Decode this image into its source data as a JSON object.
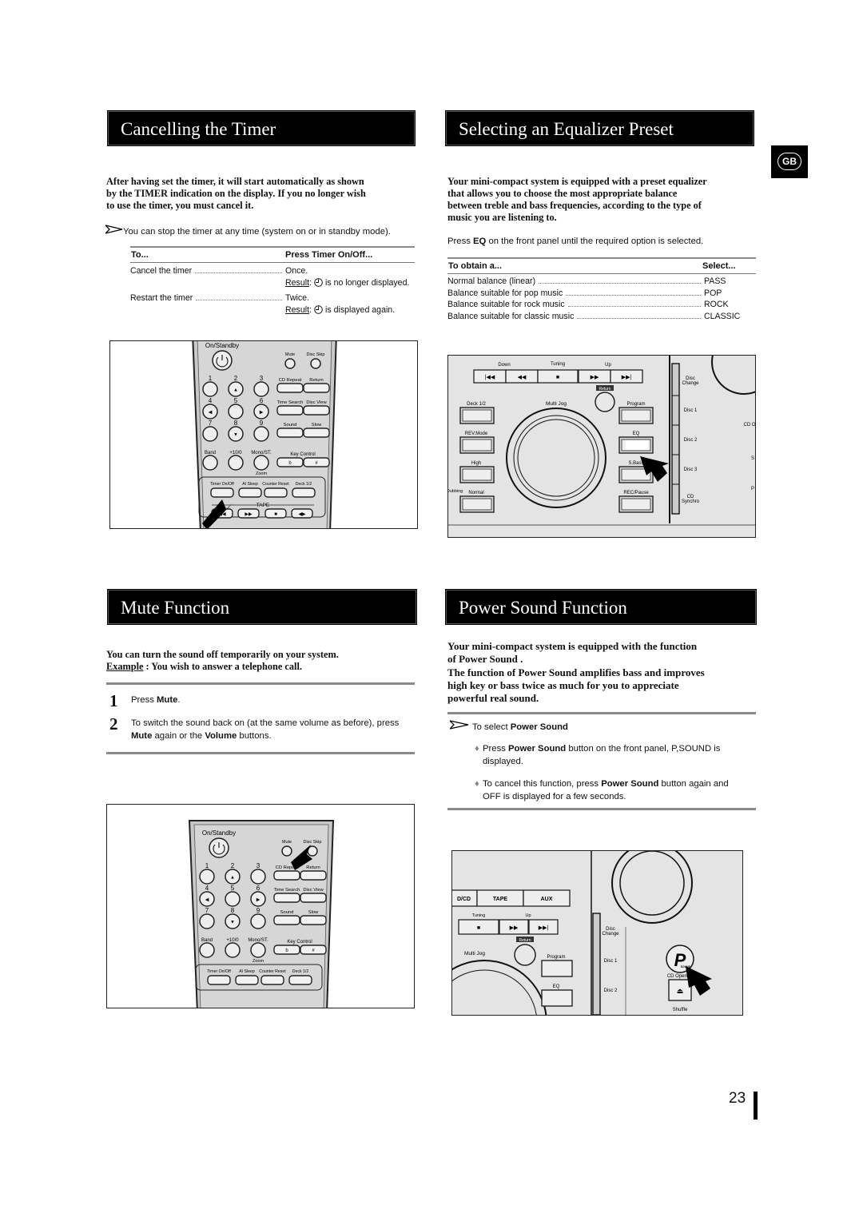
{
  "page_number": "23",
  "language_badge": "GB",
  "cancel_timer": {
    "title": "Cancelling the Timer",
    "intro": [
      "After having set the timer, it will start automatically as shown",
      "by the TIMER indication on the display. If you no longer wish",
      "to use the timer, you must cancel it."
    ],
    "note": "You can stop the timer at any time (system on or in standby mode).",
    "table_headers": [
      "To...",
      "Press Timer On/Off..."
    ],
    "rows": [
      {
        "action": "Cancel the timer",
        "value": "Once.",
        "result_label": "Result",
        "result_text": "is no longer displayed."
      },
      {
        "action": "Restart the timer",
        "value": "Twice.",
        "result_label": "Result",
        "result_text": "is displayed again."
      }
    ]
  },
  "equalizer": {
    "title": "Selecting an Equalizer Preset",
    "intro": [
      "Your mini-compact system is equipped with a preset equalizer",
      "that allows you to choose the most appropriate balance",
      "between treble and bass frequencies, according to the type of",
      "music you are listening to."
    ],
    "press_pre": "Press ",
    "press_bold": "EQ",
    "press_post": " on the front panel until the required option is selected.",
    "table_headers": [
      "To obtain a...",
      "Select..."
    ],
    "rows": [
      {
        "label": "Normal balance (linear)",
        "value": "PASS"
      },
      {
        "label": "Balance suitable for pop music",
        "value": "POP"
      },
      {
        "label": "Balance suitable for rock music",
        "value": "ROCK"
      },
      {
        "label": "Balance suitable for classic music",
        "value": "CLASSIC"
      }
    ]
  },
  "mute": {
    "title": "Mute Function",
    "intro": "You can turn the sound off temporarily on your system.",
    "example_label": "Example",
    "example_text": " : You wish to answer a telephone call.",
    "steps": [
      {
        "num": "1",
        "parts": [
          {
            "t": "Press "
          },
          {
            "t": "Mute",
            "b": true
          },
          {
            "t": "."
          }
        ]
      },
      {
        "num": "2",
        "parts": [
          {
            "t": "To switch the sound back on (at the same volume as before), press "
          },
          {
            "t": "Mute",
            "b": true
          },
          {
            "t": " again or the "
          },
          {
            "t": "Volume",
            "b": true
          },
          {
            "t": " buttons."
          }
        ]
      }
    ]
  },
  "power_sound": {
    "title": "Power Sound Function",
    "intro": [
      "Your mini-compact system is equipped with the function",
      "of Power Sound .",
      "The function of Power Sound amplifies bass and improves",
      "high key or bass twice as much for you to appreciate",
      "powerful real sound."
    ],
    "note_pre": "To select ",
    "note_bold": "Power Sound",
    "bullets": [
      [
        {
          "t": "Press "
        },
        {
          "t": "Power Sound",
          "b": true
        },
        {
          "t": " button on the front panel,  P,SOUND   is displayed."
        }
      ],
      [
        {
          "t": "To cancel this function, press "
        },
        {
          "t": "Power Sound",
          "b": true
        },
        {
          "t": " button again and  OFF  is displayed for a few seconds."
        }
      ]
    ]
  },
  "remote": {
    "power": "On/Standby",
    "mute": "Mute",
    "disc_skip": "Disc Skip",
    "numbers": [
      "1",
      "2",
      "3",
      "4",
      "5",
      "6",
      "7",
      "8",
      "9"
    ],
    "band": "Band",
    "plus10": "+10/0",
    "mono": "Mono/ST.",
    "zoom": "Zoom",
    "right": [
      "CD Repeat",
      "Return",
      "Time Search",
      "Disc View",
      "Sound",
      "Slow"
    ],
    "key_control": "Key Control",
    "key_buttons": [
      "b",
      "#"
    ],
    "bottom": [
      "Timer On/Off",
      "AI Sleep",
      "Counter Reset",
      "Deck 1/2"
    ],
    "tape": "TAPE",
    "tape_buttons": [
      "◀◀",
      "▶▶",
      "■",
      "◀▶"
    ]
  },
  "panel_eq": {
    "transport_labels": [
      "Down",
      "Tuning",
      "Up"
    ],
    "transport": [
      "|◀◀",
      "◀◀",
      "■",
      "▶▶",
      "▶▶|"
    ],
    "return": "Return",
    "multi_jog": "Multi Jog",
    "left": [
      "Deck 1/2",
      "REV.Mode",
      "High",
      "Normal"
    ],
    "dubbing": "Dubbing",
    "right": [
      "Program",
      "EQ",
      "S.Bass",
      "REC/Pause"
    ],
    "disc": [
      "Disc Change",
      "Disc 1",
      "Disc 2",
      "Disc 3",
      "CD Synchro"
    ],
    "edge": [
      "CD O",
      "S",
      "P"
    ]
  },
  "panel_power": {
    "sources": [
      "D/CD",
      "TAPE",
      "AUX"
    ],
    "tuning": "Tuning",
    "up": "Up",
    "return": "Return",
    "multi_jog": "Multi Jog",
    "program": "Program",
    "eq": "EQ",
    "disc": [
      "Disc Change",
      "Disc 1",
      "Disc 2"
    ],
    "psound": "P",
    "psound_sub": "SOUND",
    "cd_open": "CD Open/Cl",
    "shuffle": "Shuffle"
  }
}
